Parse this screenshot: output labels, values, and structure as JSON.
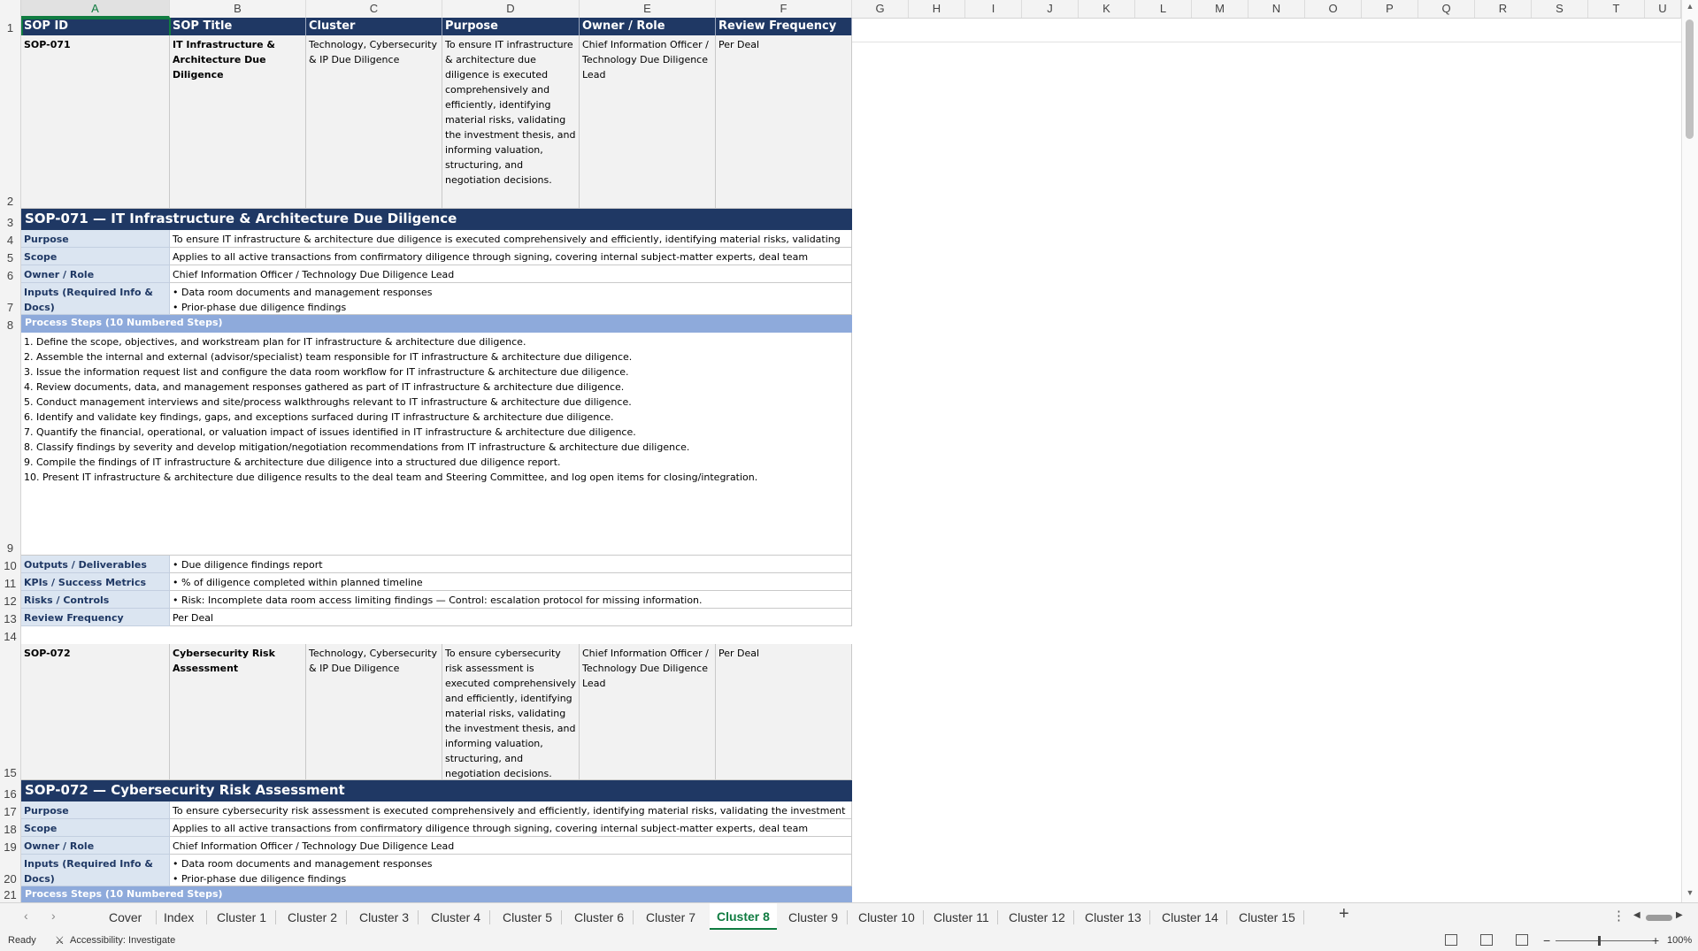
{
  "columns": [
    "A",
    "B",
    "C",
    "D",
    "E",
    "F",
    "G",
    "H",
    "I",
    "J",
    "K",
    "L",
    "M",
    "N",
    "O",
    "P",
    "Q",
    "R",
    "S",
    "T",
    "U"
  ],
  "row_numbers": [
    "1",
    "2",
    "3",
    "4",
    "5",
    "6",
    "7",
    "8",
    "9",
    "10",
    "11",
    "12",
    "13",
    "14",
    "15",
    "16",
    "17",
    "18",
    "19",
    "20",
    "21"
  ],
  "header_row": [
    "SOP ID",
    "SOP Title",
    "Cluster",
    "Purpose",
    "Owner / Role",
    "Review Frequency"
  ],
  "sop1": {
    "id": "SOP-071",
    "title": "IT Infrastructure & Architecture Due Diligence",
    "cluster": "Technology, Cybersecurity & IP Due Diligence",
    "purpose": "To ensure IT infrastructure & architecture due diligence is executed comprehensively and efficiently, identifying material risks, validating the investment thesis, and informing valuation, structuring, and negotiation decisions.",
    "owner": "Chief Information Officer / Technology Due Diligence Lead",
    "frequency": "Per Deal",
    "band": "SOP-071  —  IT Infrastructure & Architecture Due Diligence",
    "purpose_label": "Purpose",
    "purpose_full": "To ensure IT infrastructure & architecture due diligence is executed comprehensively and efficiently, identifying material risks, validating",
    "scope_label": "Scope",
    "scope": "Applies to all active transactions from confirmatory diligence through signing, covering internal subject-matter experts, deal team",
    "owner_label": "Owner / Role",
    "inputs_label": "Inputs (Required Info & Docs)",
    "inputs": "• Data room documents and management responses\n• Prior-phase due diligence findings",
    "steps_label": "Process Steps (10 Numbered Steps)",
    "steps": "1. Define the scope, objectives, and workstream plan for IT infrastructure & architecture due diligence.\n2. Assemble the internal and external (advisor/specialist) team responsible for IT infrastructure & architecture due diligence.\n3. Issue the information request list and configure the data room workflow for IT infrastructure & architecture due diligence.\n4. Review documents, data, and management responses gathered as part of IT infrastructure & architecture due diligence.\n5. Conduct management interviews and site/process walkthroughs relevant to IT infrastructure & architecture due diligence.\n6. Identify and validate key findings, gaps, and exceptions surfaced during IT infrastructure & architecture due diligence.\n7. Quantify the financial, operational, or valuation impact of issues identified in IT infrastructure & architecture due diligence.\n8. Classify findings by severity and develop mitigation/negotiation recommendations from IT infrastructure & architecture due diligence.\n9. Compile the findings of IT infrastructure & architecture due diligence into a structured due diligence report.\n10. Present IT infrastructure & architecture due diligence results to the deal team and Steering Committee, and log open items for closing/integration.",
    "outputs_label": "Outputs / Deliverables",
    "outputs": "• Due diligence findings report",
    "kpis_label": "KPIs / Success Metrics",
    "kpis": "• % of diligence completed within planned timeline",
    "risks_label": "Risks / Controls",
    "risks": "• Risk: Incomplete data room access limiting findings — Control: escalation protocol for missing information.",
    "review_label": "Review Frequency"
  },
  "sop2": {
    "id": "SOP-072",
    "title": "Cybersecurity Risk Assessment",
    "cluster": "Technology, Cybersecurity & IP Due Diligence",
    "purpose": "To ensure cybersecurity risk assessment is executed comprehensively and efficiently, identifying material risks, validating the investment thesis, and informing valuation, structuring, and negotiation decisions.",
    "owner": "Chief Information Officer / Technology Due Diligence Lead",
    "frequency": "Per Deal",
    "band": "SOP-072  —  Cybersecurity Risk Assessment",
    "purpose_label": "Purpose",
    "purpose_full": "To ensure cybersecurity risk assessment is executed comprehensively and efficiently, identifying material risks, validating the investment",
    "scope_label": "Scope",
    "scope": "Applies to all active transactions from confirmatory diligence through signing, covering internal subject-matter experts, deal team",
    "owner_label": "Owner / Role",
    "inputs_label": "Inputs (Required Info & Docs)",
    "inputs": "• Data room documents and management responses\n• Prior-phase due diligence findings",
    "steps_label": "Process Steps (10 Numbered Steps)"
  },
  "tabs": [
    "Cover",
    "Index",
    "Cluster 1",
    "Cluster 2",
    "Cluster 3",
    "Cluster 4",
    "Cluster 5",
    "Cluster 6",
    "Cluster 7",
    "Cluster 8",
    "Cluster 9",
    "Cluster 10",
    "Cluster 11",
    "Cluster 12",
    "Cluster 13",
    "Cluster 14",
    "Cluster 15"
  ],
  "active_tab": "Cluster 8",
  "status": {
    "ready": "Ready",
    "accessibility": "Accessibility: Investigate",
    "zoom": "100%"
  },
  "colors": {
    "header_navy": "#1f3864",
    "label_blue": "#dbe5f1",
    "steps_band": "#8eaadb",
    "excel_green": "#107c41"
  }
}
